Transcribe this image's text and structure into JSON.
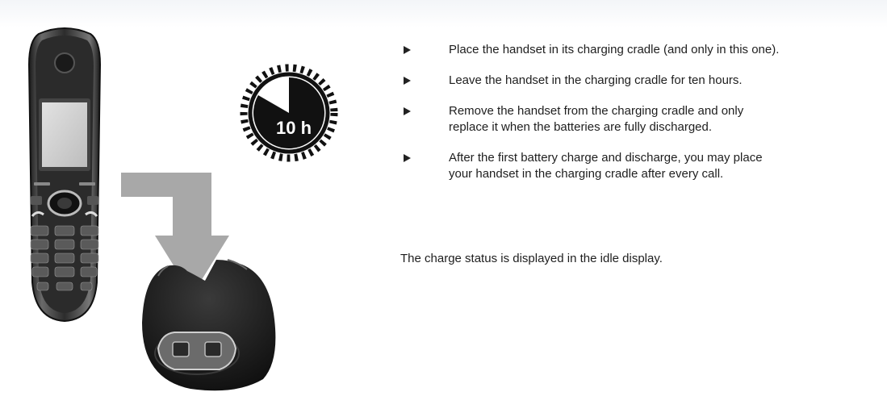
{
  "timer": {
    "label": "10 h"
  },
  "steps": [
    {
      "text": "Place the handset in its charging cradle (and only in this one)."
    },
    {
      "text": "Leave the handset in the charging cradle for ten hours."
    },
    {
      "text": "Remove the handset from the charging cradle and only\nreplace it when the batteries are fully discharged."
    },
    {
      "text": "After the first battery charge and discharge, you may place\nyour handset in the charging cradle after every call."
    }
  ],
  "note": "The charge status is displayed in the idle display.",
  "icons": [
    "handset-icon",
    "timer-icon",
    "down-arrow-icon",
    "charging-cradle-icon",
    "bullet-arrow-icon"
  ],
  "colors": {
    "text": "#1e1e1e",
    "arrow": "#a8a8a8",
    "device": "#222222"
  }
}
